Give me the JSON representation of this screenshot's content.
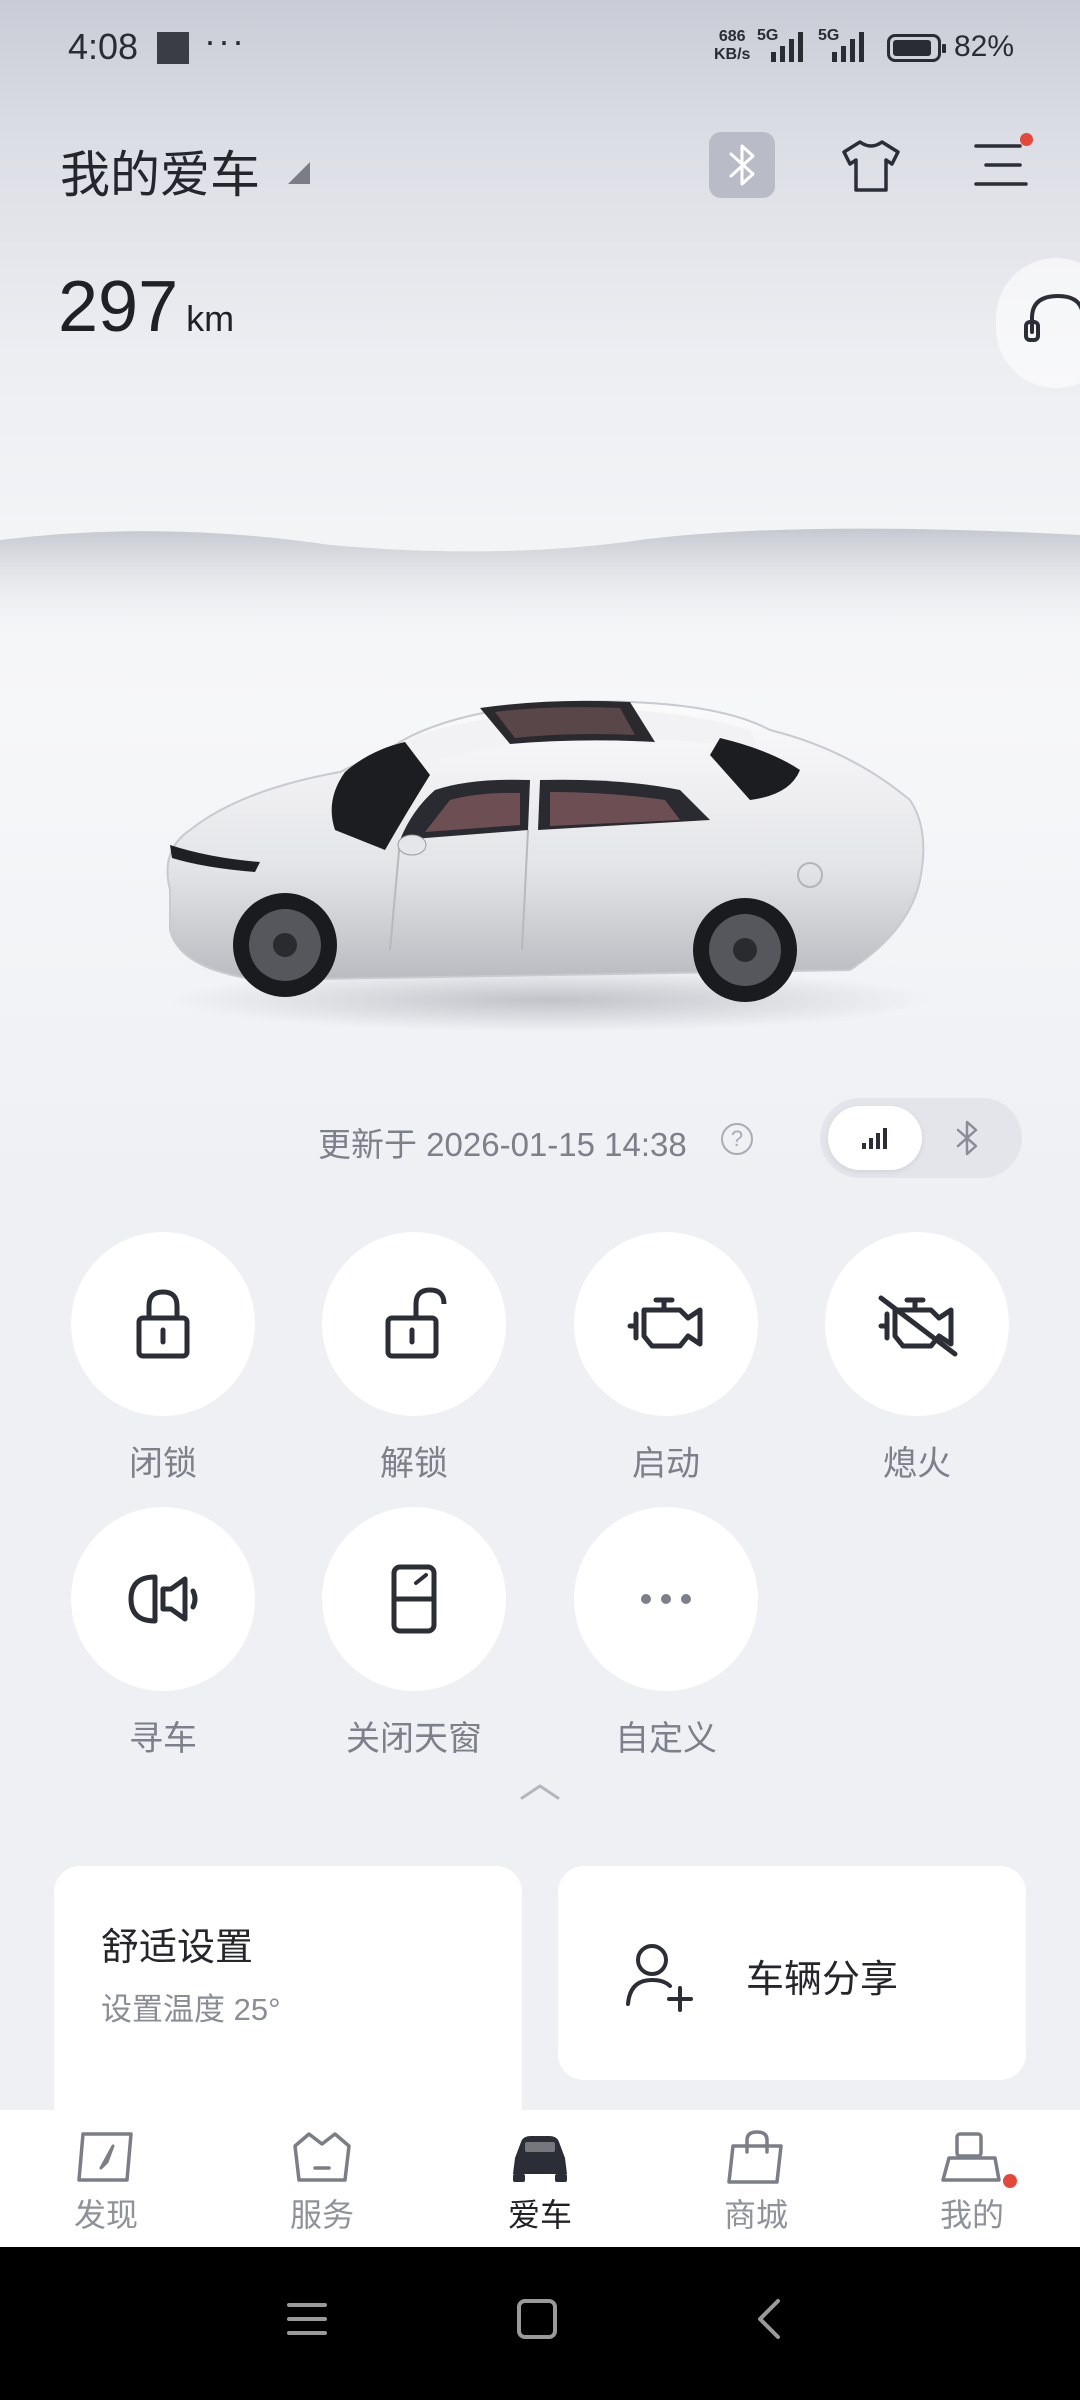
{
  "status_bar": {
    "time": "4:08",
    "overflow": "···",
    "net_speed_value": "686",
    "net_speed_unit": "KB/s",
    "sim1": "5G",
    "sim2": "5G",
    "battery": "82%"
  },
  "header": {
    "title": "我的爱车",
    "icons": [
      "bluetooth-icon",
      "shirt-icon",
      "menu-icon",
      "support-headset-icon"
    ]
  },
  "vehicle": {
    "range_value": "297",
    "range_unit": "km",
    "update_text": "更新于 2026-01-15 14:38",
    "help_glyph": "?",
    "connection_modes": [
      "signal",
      "bluetooth"
    ],
    "active_mode": "signal"
  },
  "actions": [
    {
      "label": "闭锁",
      "icon": "lock-icon"
    },
    {
      "label": "解锁",
      "icon": "unlock-icon"
    },
    {
      "label": "启动",
      "icon": "engine-start-icon"
    },
    {
      "label": "熄火",
      "icon": "engine-off-icon"
    },
    {
      "label": "寻车",
      "icon": "find-car-icon"
    },
    {
      "label": "关闭天窗",
      "icon": "sunroof-icon"
    },
    {
      "label": "自定义",
      "icon": "more-icon"
    }
  ],
  "cards": {
    "comfort_title": "舒适设置",
    "comfort_sub": "设置温度 25°",
    "share_title": "车辆分享"
  },
  "tabs": [
    {
      "label": "发现",
      "icon": "compass-icon"
    },
    {
      "label": "服务",
      "icon": "service-icon"
    },
    {
      "label": "爱车",
      "icon": "car-icon"
    },
    {
      "label": "商城",
      "icon": "shopping-bag-icon"
    },
    {
      "label": "我的",
      "icon": "profile-icon"
    }
  ],
  "active_tab": "爱车",
  "colors": {
    "accent": "#2b2e36",
    "badge": "#e5473a",
    "background": "#eef0f4"
  }
}
